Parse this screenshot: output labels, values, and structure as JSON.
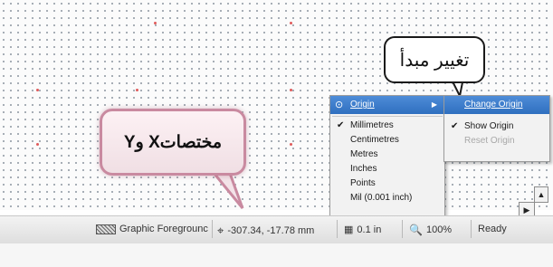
{
  "callouts": {
    "change_origin_ar": "تغيير مبدأ",
    "xy_coordinates_ar": "مختصاتX وY"
  },
  "origin_menu": {
    "header": "Origin",
    "items": [
      {
        "label": "Millimetres",
        "checked": true
      },
      {
        "label": "Centimetres",
        "checked": false
      },
      {
        "label": "Metres",
        "checked": false
      },
      {
        "label": "Inches",
        "checked": false
      },
      {
        "label": "Points",
        "checked": false
      },
      {
        "label": "Mil (0.001 inch)",
        "checked": false
      }
    ]
  },
  "origin_submenu": {
    "items": [
      {
        "label": "Change Origin",
        "highlighted": true,
        "disabled": false
      },
      {
        "label": "Show Origin",
        "checked": true,
        "disabled": false
      },
      {
        "label": "Reset Origin",
        "disabled": true
      }
    ]
  },
  "statusbar": {
    "layer": "Graphic Foregrounc",
    "coordinates": "-307.34, -17.78 mm",
    "grid": "0.1 in",
    "zoom": "100%",
    "status": "Ready"
  },
  "colors": {
    "highlight": "#3a7bd5",
    "callout_border": "#c98aa0",
    "grid_dot": "#9aa2ab",
    "origin_dot": "#e05a5a"
  }
}
